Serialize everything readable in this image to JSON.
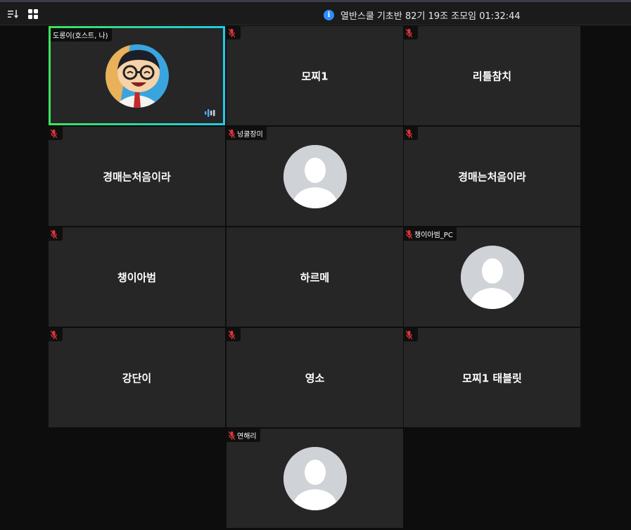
{
  "meeting": {
    "title": "열반스쿨 기초반 82기 19조 조모임 01:32:44",
    "info_icon": "info-icon"
  },
  "toolbar": {
    "sort_icon": "sort-icon",
    "grid_view_icon": "grid-view-icon"
  },
  "colors": {
    "tile_bg": "#262626",
    "active_border_start": "#3ee35c",
    "active_border_end": "#23c9e8",
    "muted_mic": "#e0343a",
    "info_blue": "#2d8cff",
    "avatar_gray": "#cfd2d6"
  },
  "participants": [
    {
      "name": "도롱이(호스트, 나)",
      "display": "photo",
      "muted": false,
      "active_speaker": true
    },
    {
      "name": "모찌1",
      "display": "name",
      "muted": true
    },
    {
      "name": "리틀참치",
      "display": "name",
      "muted": true
    },
    {
      "name": "경매는처음이라",
      "display": "name",
      "muted": true
    },
    {
      "name": "넝쿨장미",
      "display": "avatar",
      "muted": true
    },
    {
      "name": "경매는처음이라",
      "display": "name",
      "muted": true
    },
    {
      "name": "챙이아범",
      "display": "name",
      "muted": true
    },
    {
      "name": "하르메",
      "display": "name",
      "muted": false
    },
    {
      "name": "챙이아범_PC",
      "display": "avatar",
      "muted": true
    },
    {
      "name": "강단이",
      "display": "name",
      "muted": true
    },
    {
      "name": "영소",
      "display": "name",
      "muted": true
    },
    {
      "name": "모찌1 태블릿",
      "display": "name",
      "muted": true
    },
    {
      "name": "연해리",
      "display": "avatar",
      "muted": true
    }
  ]
}
